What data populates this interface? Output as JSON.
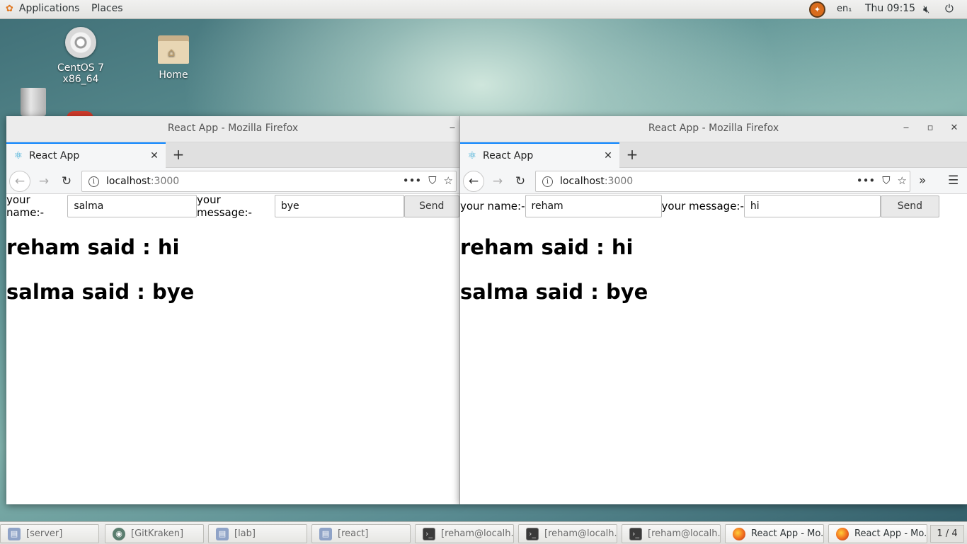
{
  "topbar": {
    "applications": "Applications",
    "places": "Places",
    "language": "en₁",
    "clock": "Thu 09:15"
  },
  "desktop": {
    "centos_label_1": "CentOS 7",
    "centos_label_2": "x86_64",
    "home_label": "Home"
  },
  "windows": [
    {
      "title": "React App - Mozilla Firefox",
      "tab_title": "React App",
      "url_host": "localhost",
      "url_port": ":3000",
      "name_label": "your name:-",
      "name_value": "salma",
      "message_label": "your message:-",
      "message_value": "bye",
      "send_label": "Send",
      "messages": [
        "reham said : hi",
        "salma said : bye"
      ]
    },
    {
      "title": "React App - Mozilla Firefox",
      "tab_title": "React App",
      "url_host": "localhost",
      "url_port": ":3000",
      "name_label": "your name:-",
      "name_value": "reham",
      "message_label": "your message:-",
      "message_value": "hi",
      "send_label": "Send",
      "messages": [
        "reham said : hi",
        "salma said : bye"
      ]
    }
  ],
  "taskbar": {
    "items": [
      {
        "label": "[server]",
        "icon": "folder-icon"
      },
      {
        "label": "[GitKraken]",
        "icon": "gitkraken-icon"
      },
      {
        "label": "[lab]",
        "icon": "folder-icon"
      },
      {
        "label": "[react]",
        "icon": "folder-icon"
      },
      {
        "label": "[reham@localh...",
        "icon": "terminal-icon"
      },
      {
        "label": "[reham@localh...",
        "icon": "terminal-icon"
      },
      {
        "label": "[reham@localh...",
        "icon": "terminal-icon"
      },
      {
        "label": "React App - Mo...",
        "icon": "firefox-icon"
      },
      {
        "label": "React App - Mo...",
        "icon": "firefox-icon"
      }
    ],
    "workspace": "1 / 4"
  }
}
